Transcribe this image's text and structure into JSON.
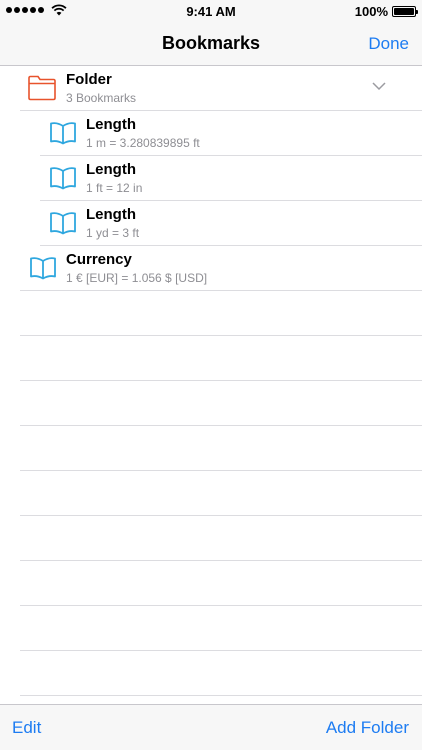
{
  "status_bar": {
    "time": "9:41 AM",
    "battery": "100%"
  },
  "nav": {
    "title": "Bookmarks",
    "done_label": "Done"
  },
  "folder": {
    "title": "Folder",
    "subtitle": "3 Bookmarks",
    "icon": "folder-icon",
    "color": "#e8532c",
    "expanded": true
  },
  "bookmarks": [
    {
      "title": "Length",
      "subtitle": "1 m = 3.280839895 ft",
      "icon": "book-icon",
      "in_folder": true
    },
    {
      "title": "Length",
      "subtitle": "1 ft = 12 in",
      "icon": "book-icon",
      "in_folder": true
    },
    {
      "title": "Length",
      "subtitle": "1 yd = 3 ft",
      "icon": "book-icon",
      "in_folder": true
    },
    {
      "title": "Currency",
      "subtitle": "1 € [EUR] = 1.056 $ [USD]",
      "icon": "book-icon",
      "in_folder": false
    }
  ],
  "toolbar": {
    "edit_label": "Edit",
    "add_folder_label": "Add Folder"
  },
  "colors": {
    "accent": "#1d7cf2",
    "book_icon": "#2fa7df",
    "folder_icon": "#e8532c",
    "secondary_text": "#8e8e93"
  }
}
